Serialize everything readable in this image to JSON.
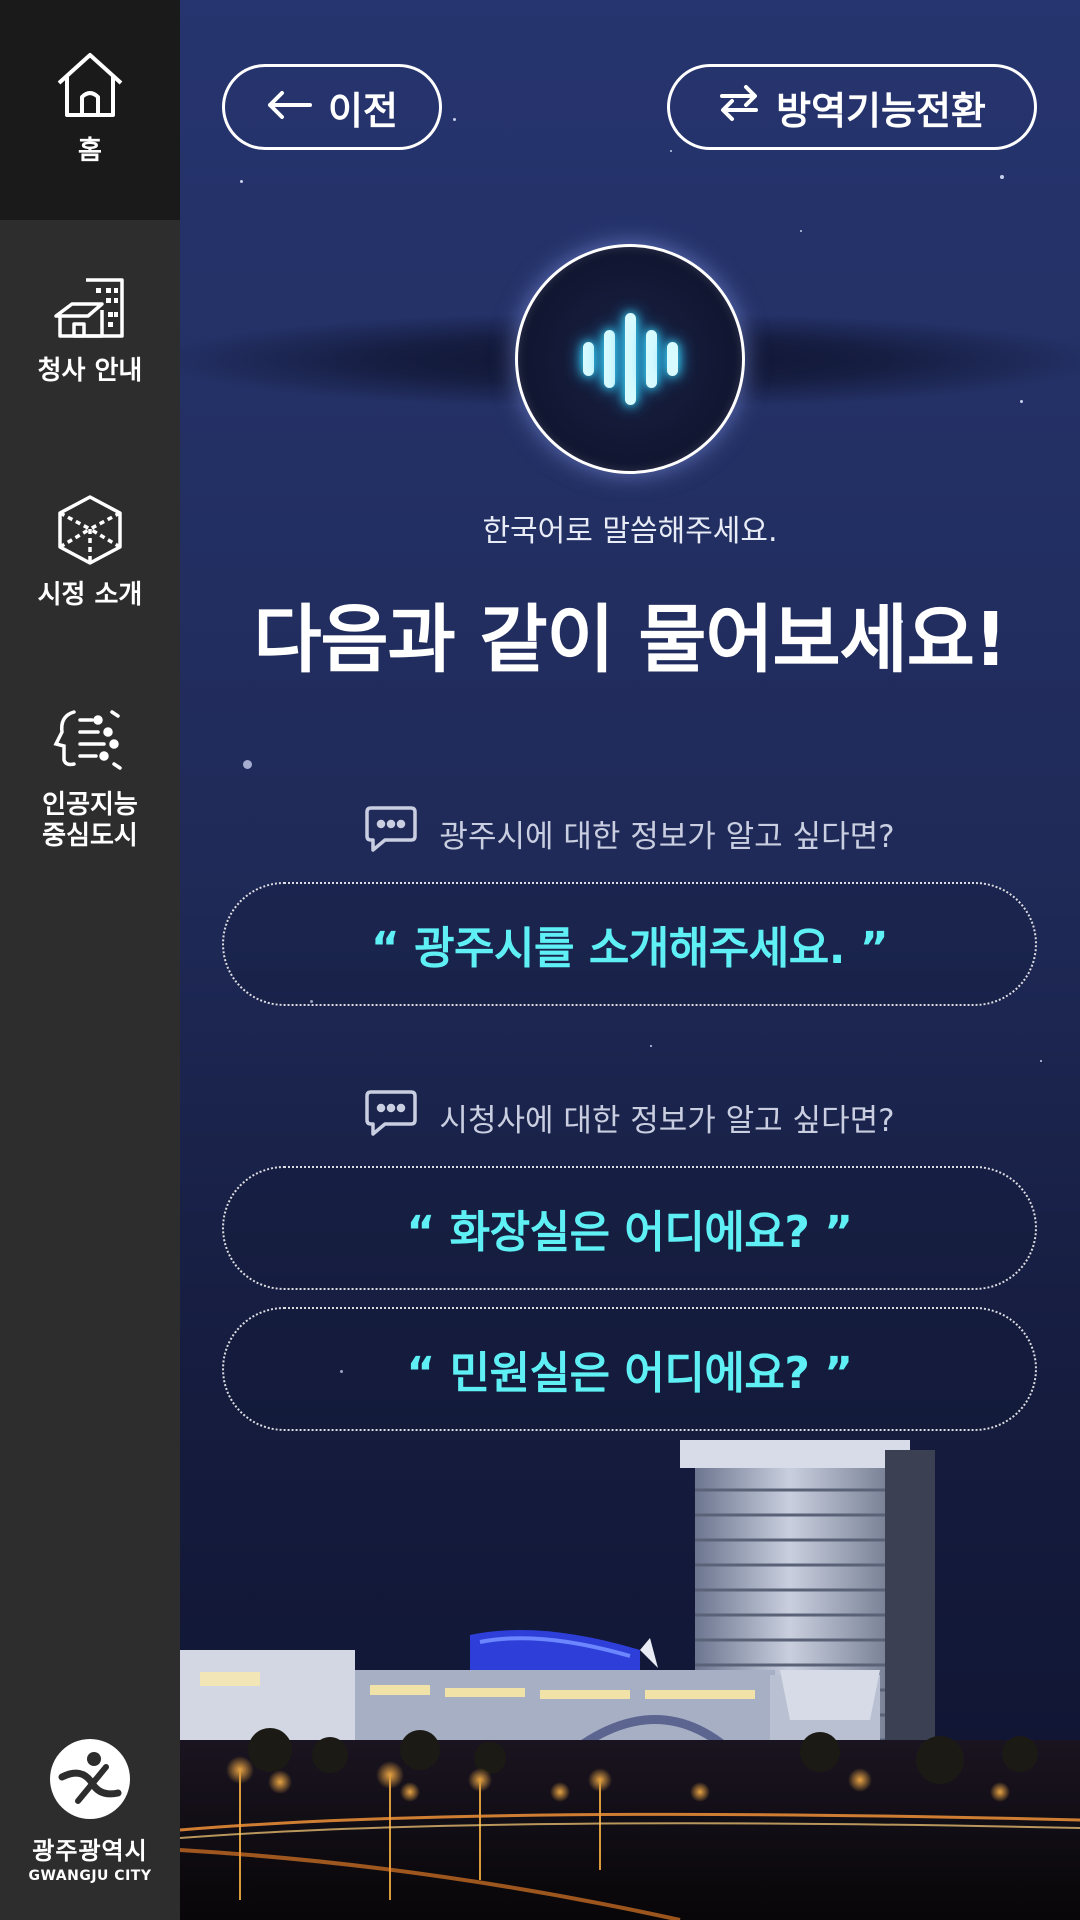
{
  "sidebar": {
    "items": [
      {
        "label": "홈",
        "icon": "home-icon"
      },
      {
        "label": "청사 안내",
        "icon": "building-icon"
      },
      {
        "label": "시정 소개",
        "icon": "cube-icon"
      },
      {
        "label": "인공지능\n중심도시",
        "icon": "ai-head-icon"
      }
    ],
    "logo": {
      "name": "광주광역시",
      "name_en": "GWANGJU CITY"
    }
  },
  "header": {
    "back_label": "이전",
    "switch_label": "방역기능전환"
  },
  "voice": {
    "instruction": "한국어로 말씀해주세요.",
    "headline": "다음과 같이 물어보세요!"
  },
  "sections": [
    {
      "label": "광주시에 대한 정보가 알고 싶다면?",
      "examples": [
        "“ 광주시를 소개해주세요. ”"
      ]
    },
    {
      "label": "시청사에 대한 정보가 알고 싶다면?",
      "examples": [
        "“ 화장실은 어디에요? ”",
        "“ 민원실은 어디에요? ”"
      ]
    }
  ],
  "colors": {
    "accent": "#5ef0f4",
    "sidebar_bg": "#2d2d2e",
    "sidebar_active": "#1a1a1b",
    "main_bg": "#243166"
  }
}
